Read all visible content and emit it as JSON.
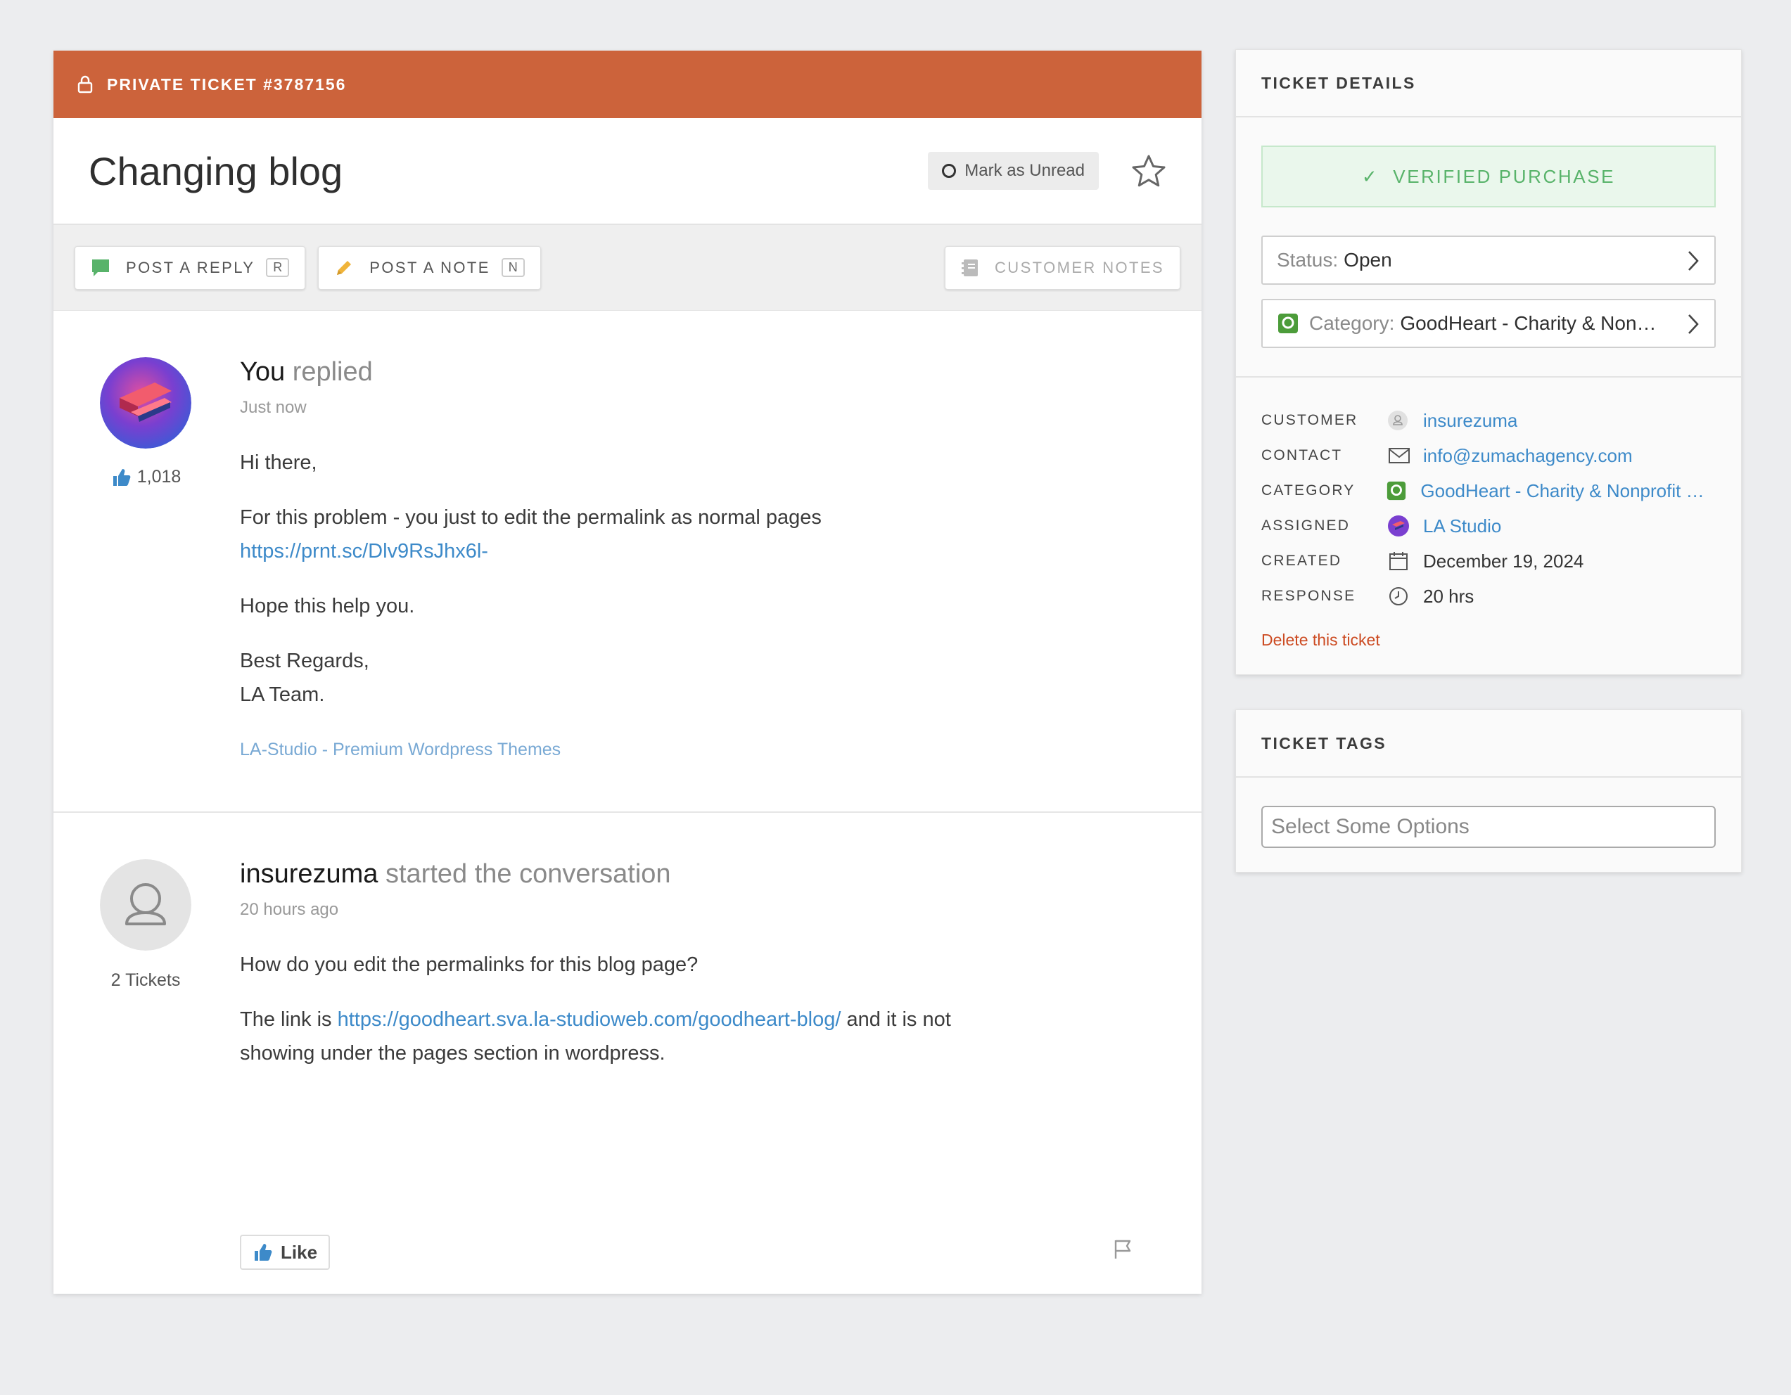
{
  "ticket": {
    "banner_label": "PRIVATE TICKET #3787156",
    "title": "Changing blog",
    "mark_unread_label": "Mark as Unread"
  },
  "toolbar": {
    "post_reply_label": "POST A REPLY",
    "post_reply_key": "R",
    "post_note_label": "POST A NOTE",
    "post_note_key": "N",
    "customer_notes_label": "CUSTOMER NOTES"
  },
  "messages": [
    {
      "author": "You",
      "verb": "replied",
      "time": "Just now",
      "likes": "1,018",
      "greeting": "Hi there,",
      "line1": "For this problem - you just to edit the permalink as normal pages",
      "link": "https://prnt.sc/Dlv9RsJhx6l-",
      "line2": "Hope this help you.",
      "closing1": "Best Regards,",
      "closing2": "LA Team.",
      "signature": "LA-Studio - Premium Wordpress Themes"
    },
    {
      "author": "insurezuma",
      "verb": "started the conversation",
      "time": "20 hours ago",
      "ticket_count": "2 Tickets",
      "line1": "How do you edit the permalinks for this blog page?",
      "line2_prefix": "The link is",
      "link": "https://goodheart.sva.la-studioweb.com/goodheart-blog/",
      "line2_suffix": "and it is not",
      "line3": "showing under the pages section in wordpress.",
      "like_label": "Like"
    }
  ],
  "details": {
    "heading": "TICKET DETAILS",
    "verified_label": "VERIFIED PURCHASE",
    "status_label": "Status:",
    "status_value": "Open",
    "category_label": "Category:",
    "category_value": "GoodHeart - Charity & Non…",
    "rows": [
      {
        "key": "CUSTOMER",
        "value": "insurezuma",
        "icon": "user-icon"
      },
      {
        "key": "CONTACT",
        "value": "info@zumachagency.com",
        "icon": "mail-icon"
      },
      {
        "key": "CATEGORY",
        "value": "GoodHeart - Charity & Nonprofit El…",
        "icon": "category-icon"
      },
      {
        "key": "ASSIGNED",
        "value": "LA Studio",
        "icon": "la-studio-avatar"
      },
      {
        "key": "CREATED",
        "value": "December 19, 2024",
        "icon": "calendar-icon"
      },
      {
        "key": "RESPONSE",
        "value": "20 hrs",
        "icon": "clock-icon"
      }
    ],
    "delete_label": "Delete this ticket"
  },
  "tags": {
    "heading": "TICKET TAGS",
    "placeholder": "Select Some Options"
  },
  "colors": {
    "banner": "#cc633b",
    "link": "#3d8ac9",
    "verified": "#58b36a",
    "delete": "#cc4b22"
  }
}
